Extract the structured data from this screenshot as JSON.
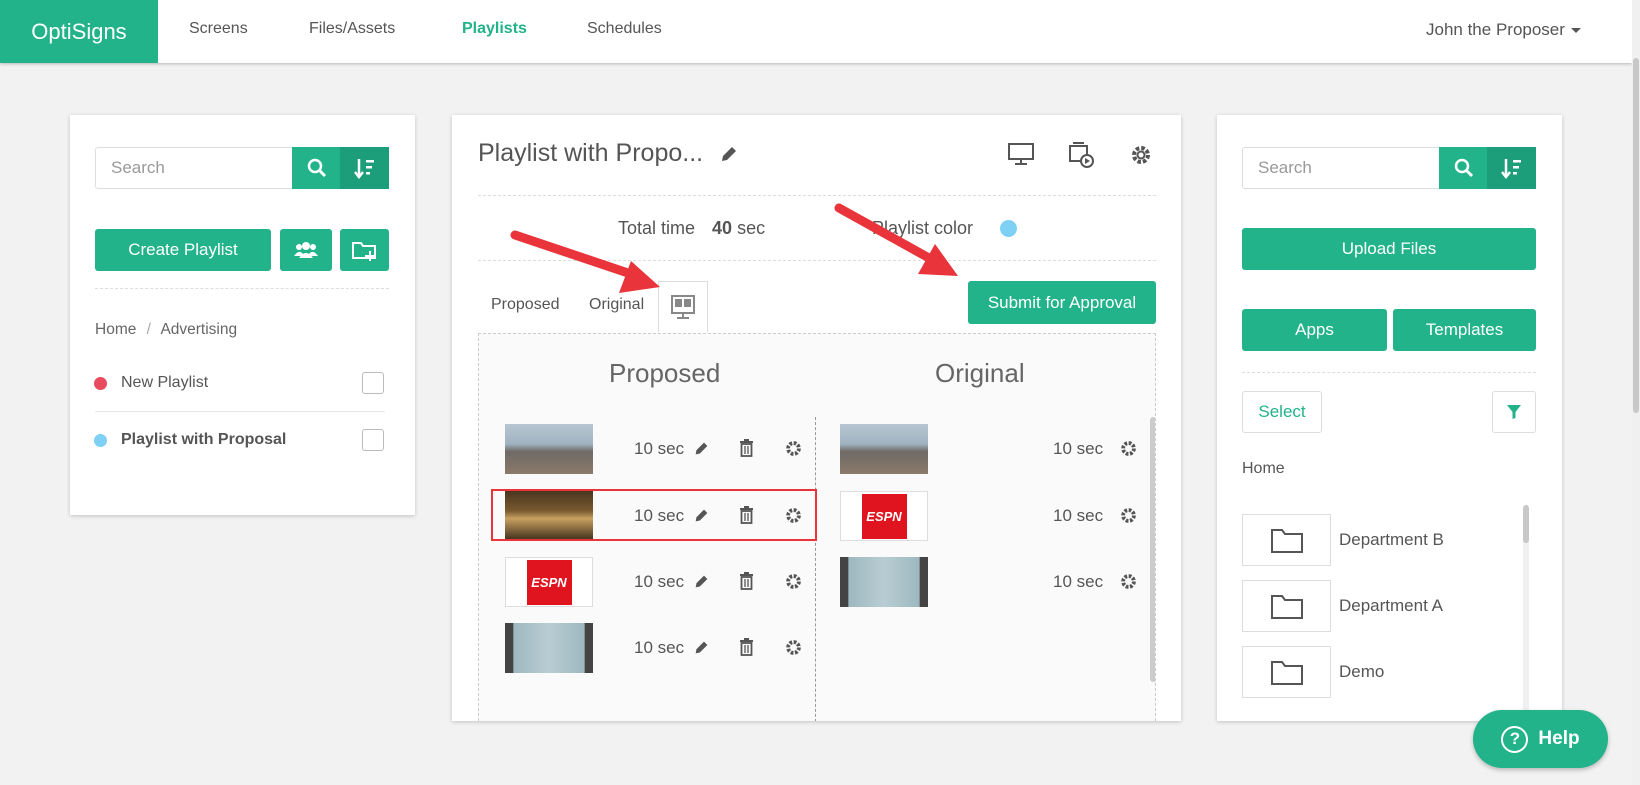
{
  "brand": "OptiSigns",
  "nav": {
    "screens": "Screens",
    "files": "Files/Assets",
    "playlists": "Playlists",
    "schedules": "Schedules",
    "user": "John the Proposer"
  },
  "left": {
    "search_placeholder": "Search",
    "create_playlist": "Create Playlist",
    "breadcrumb_home": "Home",
    "breadcrumb_sep": "/",
    "breadcrumb_current": "Advertising",
    "playlists": [
      {
        "name": "New Playlist",
        "color": "#e84a5f"
      },
      {
        "name": "Playlist with Proposal",
        "color": "#7fd0f5"
      }
    ]
  },
  "middle": {
    "title": "Playlist with Propo...",
    "total_time_label": "Total time",
    "total_time_value": "40",
    "total_time_unit": "sec",
    "playlist_color_label": "Playlist color",
    "playlist_color": "#7fd0f5",
    "tabs": [
      "Proposed",
      "Original"
    ],
    "submit_label": "Submit for Approval",
    "proposed_header": "Proposed",
    "original_header": "Original",
    "proposed_items": [
      {
        "thumb": "city",
        "duration": "10 sec"
      },
      {
        "thumb": "bar",
        "duration": "10 sec"
      },
      {
        "thumb": "espn",
        "duration": "10 sec"
      },
      {
        "thumb": "flower",
        "duration": "10 sec"
      }
    ],
    "original_items": [
      {
        "thumb": "city",
        "duration": "10 sec"
      },
      {
        "thumb": "espn",
        "duration": "10 sec"
      },
      {
        "thumb": "flower",
        "duration": "10 sec"
      }
    ],
    "espn_text": "ESPN"
  },
  "right": {
    "search_placeholder": "Search",
    "upload_files": "Upload Files",
    "apps": "Apps",
    "templates": "Templates",
    "select": "Select",
    "breadcrumb_home": "Home",
    "folders": [
      "Department B",
      "Department A",
      "Demo"
    ]
  },
  "help": "Help",
  "accent_color": "#22b38a",
  "annotation_color": "#e8343a"
}
